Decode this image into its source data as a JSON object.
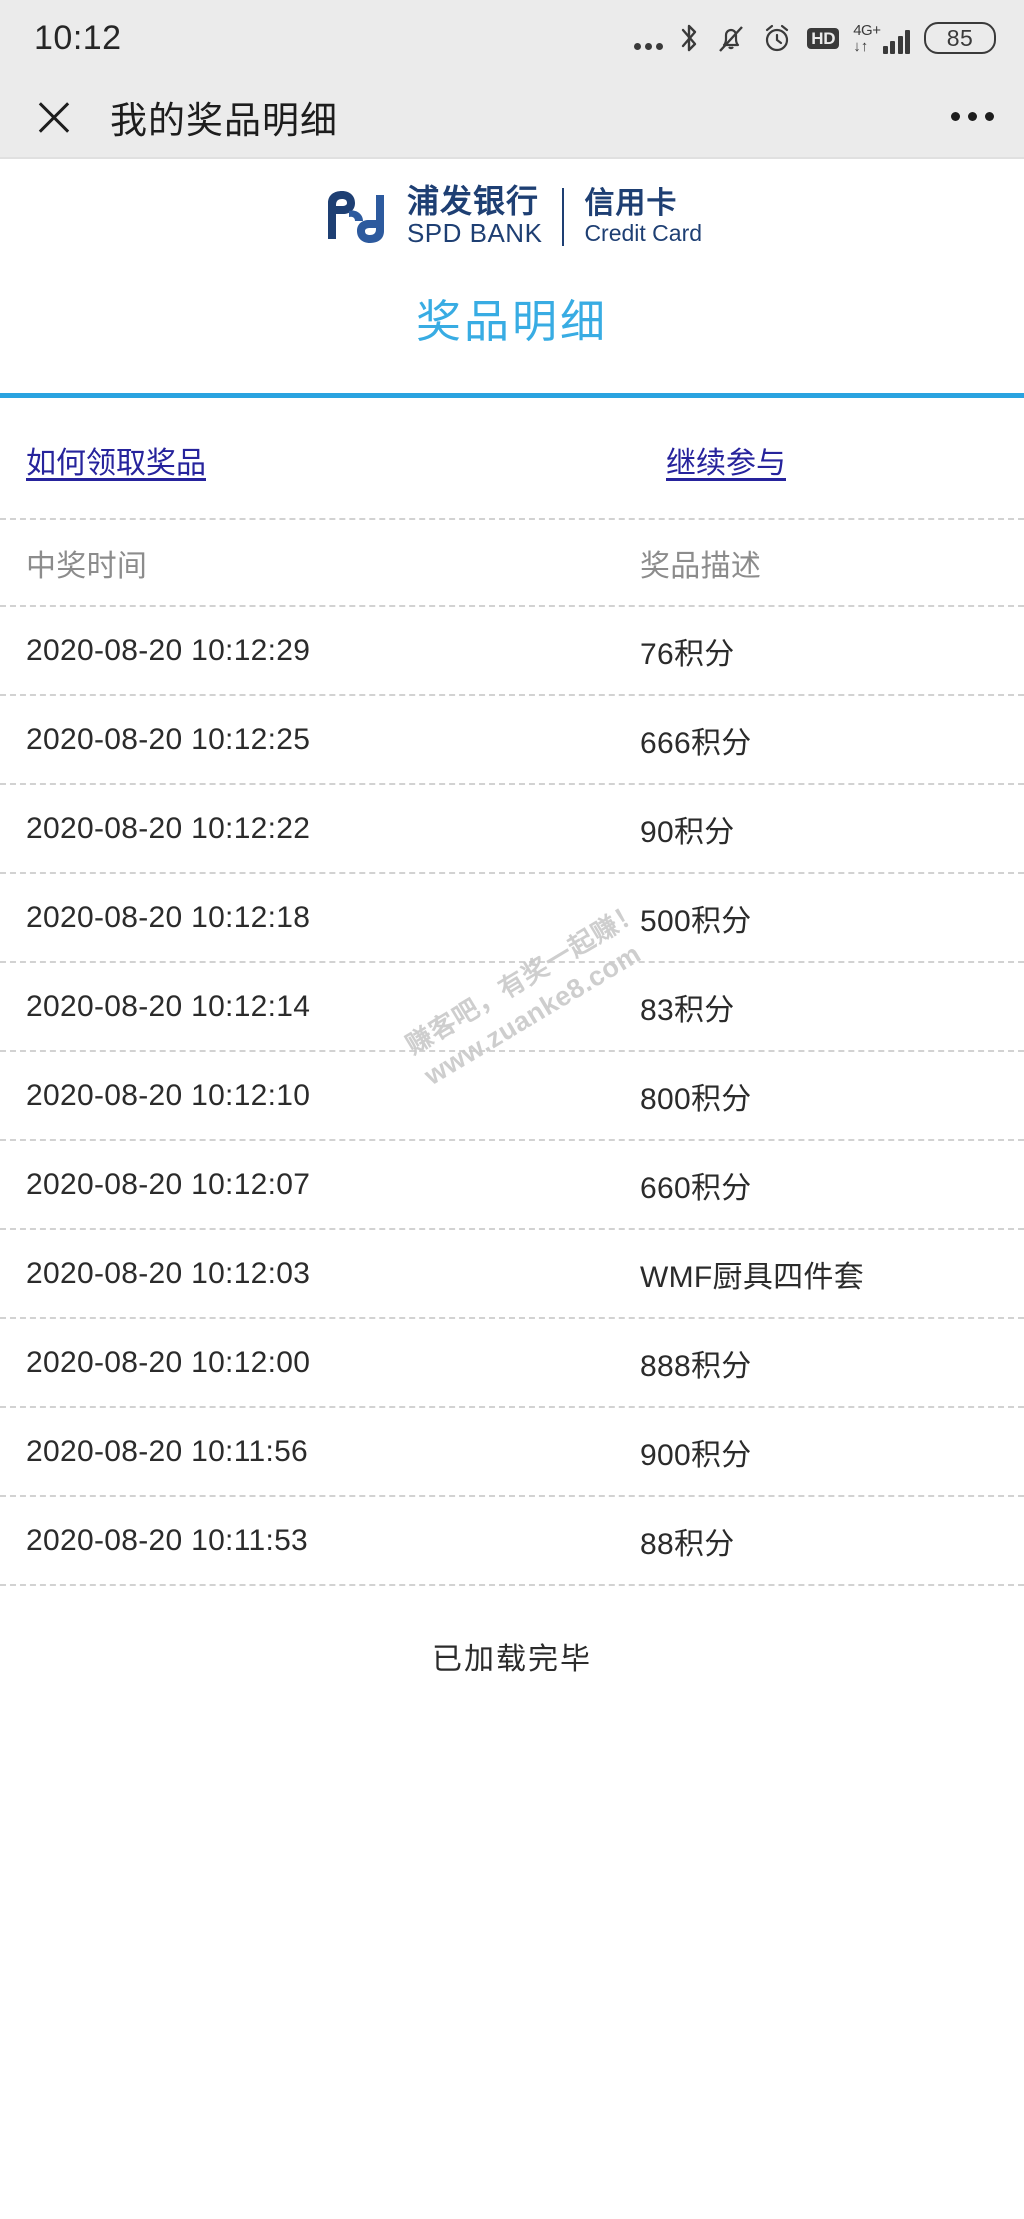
{
  "status_bar": {
    "time": "10:12",
    "icons": [
      {
        "name": "three-dots-icon",
        "label": "•••"
      },
      {
        "name": "bluetooth-icon",
        "label": "Bluetooth"
      },
      {
        "name": "bell-muted-icon",
        "label": "Silent"
      },
      {
        "name": "alarm-clock-icon",
        "label": "Alarm"
      },
      {
        "name": "hd-icon",
        "label": "HD"
      },
      {
        "name": "signal-4g-plus-icon",
        "label": "4G+"
      },
      {
        "name": "battery-icon",
        "label": "85"
      }
    ],
    "network_label": "4G+",
    "data_transfer": "↓↑",
    "battery_level": "85"
  },
  "nav": {
    "close_label": "×",
    "title": "我的奖品明细",
    "more_label": "•••"
  },
  "brand": {
    "name_cn": "浦发银行",
    "name_en": "SPD BANK",
    "product_cn": "信用卡",
    "product_en": "Credit Card",
    "color": "#1e3f73"
  },
  "page": {
    "title": "奖品明细",
    "title_color": "#38ace3",
    "rule_color": "#2aa3e0"
  },
  "links": {
    "how_to_claim": "如何领取奖品",
    "continue": "继续参与",
    "color": "#26239c"
  },
  "table": {
    "headers": {
      "time": "中奖时间",
      "prize": "奖品描述"
    },
    "rows": [
      {
        "time": "2020-08-20 10:12:29",
        "prize": "76积分"
      },
      {
        "time": "2020-08-20 10:12:25",
        "prize": "666积分"
      },
      {
        "time": "2020-08-20 10:12:22",
        "prize": "90积分"
      },
      {
        "time": "2020-08-20 10:12:18",
        "prize": "500积分"
      },
      {
        "time": "2020-08-20 10:12:14",
        "prize": "83积分"
      },
      {
        "time": "2020-08-20 10:12:10",
        "prize": "800积分"
      },
      {
        "time": "2020-08-20 10:12:07",
        "prize": "660积分"
      },
      {
        "time": "2020-08-20 10:12:03",
        "prize": "WMF厨具四件套"
      },
      {
        "time": "2020-08-20 10:12:00",
        "prize": "888积分"
      },
      {
        "time": "2020-08-20 10:11:56",
        "prize": "900积分"
      },
      {
        "time": "2020-08-20 10:11:53",
        "prize": "88积分"
      }
    ]
  },
  "footer": {
    "loaded_note": "已加载完毕"
  },
  "watermark": {
    "line1": "赚客吧，有奖一起赚！",
    "line2": "www.zuanke8.com"
  }
}
